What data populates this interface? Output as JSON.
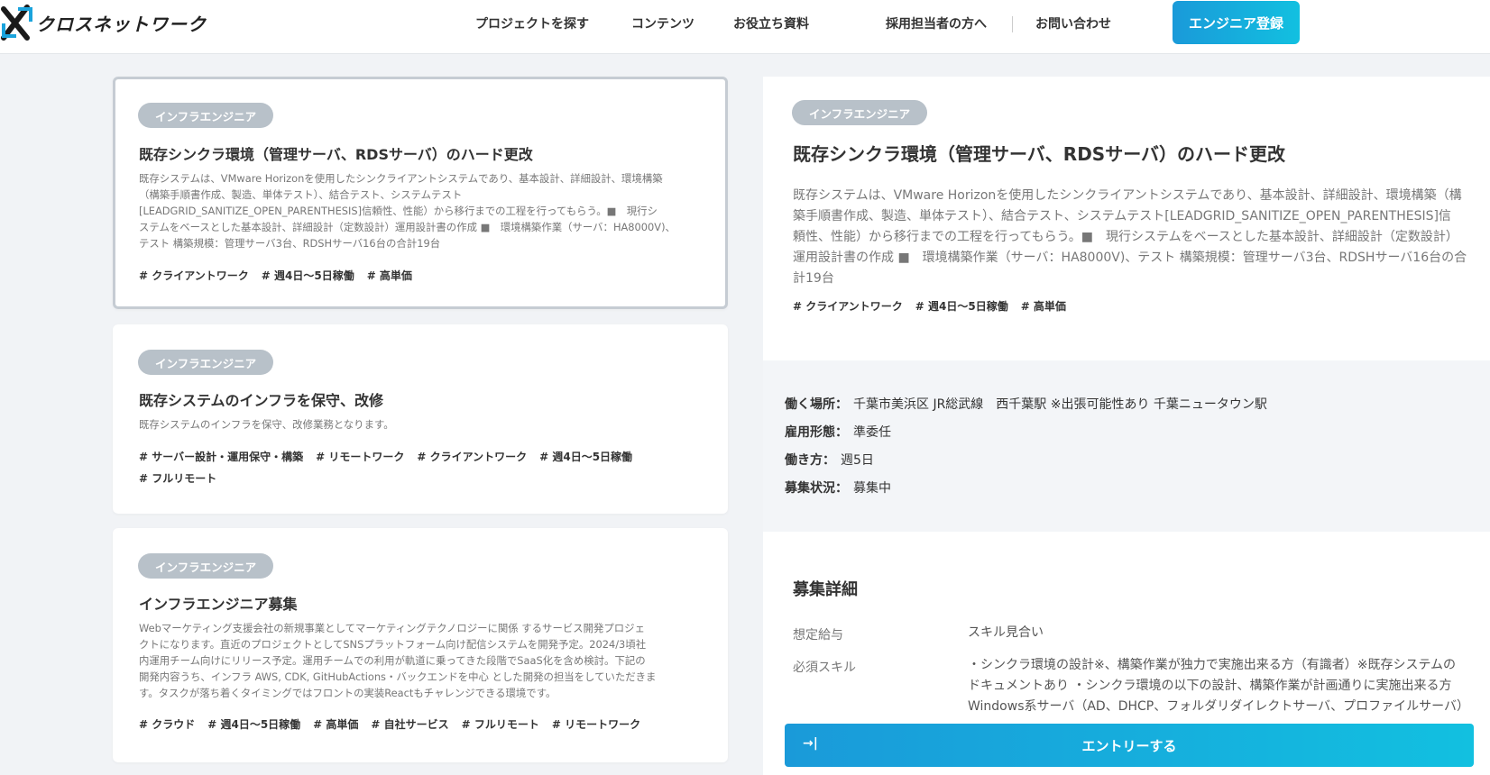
{
  "brand": {
    "name": "クロスネットワーク"
  },
  "nav": {
    "items": [
      "プロジェクトを探す",
      "コンテンツ",
      "お役立ち資料",
      "採用担当者の方へ",
      "お問い合わせ"
    ],
    "cta": "エンジニア登録"
  },
  "cards": [
    {
      "category": "インフラエンジニア",
      "title": "既存シンクラ環境（管理サーバ、RDSサーバ）のハード更改",
      "desc_lines": [
        "既存システムは、VMware Horizonを使用したシンクライアントシステムであり、基本設計、詳細設計、環境構築",
        "（構築手順書作成、製造、単体テスト）、結合テスト、システムテスト",
        "[LEADGRID_SANITIZE_OPEN_PARENTHESIS]信頼性、性能）から移行までの工程を行ってもらう。■　現行シ",
        "ステムをベースとした基本設計、詳細設計（定数設計）運用設計書の作成 ■　環境構築作業（サーバ：HA8000V)、",
        "テスト 構築規模：管理サーバ3台、RDSHサーバ16台の合計19台"
      ],
      "tags": [
        "# クライアントワーク",
        "# 週4日～5日稼働",
        "# 高単価"
      ]
    },
    {
      "category": "インフラエンジニア",
      "title": "既存システムのインフラを保守、改修",
      "desc_lines": [
        "既存システムのインフラを保守、改修業務となります。"
      ],
      "tags": [
        "# サーバー設計・運用保守・構築",
        "# リモートワーク",
        "# クライアントワーク",
        "# 週4日～5日稼働",
        "# フルリモート"
      ]
    },
    {
      "category": "インフラエンジニア",
      "title": "インフラエンジニア募集",
      "desc_lines": [
        "Webマーケティング支援会社の新規事業としてマーケティングテクノロジーに関係 するサービス開発プロジェ",
        "クトになります。直近のプロジェクトとしてSNSプラットフォーム向け配信システムを開発予定。2024/3頃社",
        "内運用チーム向けにリリース予定。運用チームでの利用が軌道に乗ってきた段階でSaaS化を含め検討。下記の",
        "開発内容うち、インフラ AWS, CDK, GitHubActions・バックエンドを中心 とした開発の担当をしていただきま",
        "す。タスクが落ち着くタイミングではフロントの実装Reactもチャレンジできる環境です。"
      ],
      "tags": [
        "# クラウド",
        "# 週4日～5日稼働",
        "# 高単価",
        "# 自社サービス",
        "# フルリモート",
        "# リモートワーク"
      ]
    }
  ],
  "detail": {
    "category": "インフラエンジニア",
    "title": "既存シンクラ環境（管理サーバ、RDSサーバ）のハード更改",
    "desc_lines": [
      "既存システムは、VMware Horizonを使用したシンクライアントシステムであり、基本設計、詳細設計、環境構築（構",
      "築手順書作成、製造、単体テスト）、結合テスト、システムテスト[LEADGRID_SANITIZE_OPEN_PARENTHESIS]信",
      "頼性、性能）から移行までの工程を行ってもらう。■　現行システムをベースとした基本設計、詳細設計（定数設計）",
      "運用設計書の作成 ■　環境構築作業（サーバ：HA8000V)、テスト 構築規模：管理サーバ3台、RDSHサーバ16台の合",
      "計19台"
    ],
    "tags": [
      "# クライアントワーク",
      "# 週4日～5日稼働",
      "# 高単価"
    ],
    "info": [
      {
        "label": "働く場所：",
        "value": "千葉市美浜区 JR総武線　西千葉駅 ※出張可能性あり 千葉ニュータウン駅"
      },
      {
        "label": "雇用形態：",
        "value": "準委任"
      },
      {
        "label": "働き方：",
        "value": "週5日"
      },
      {
        "label": "募集状況：",
        "value": "募集中"
      }
    ],
    "section_title": "募集詳細",
    "specs": [
      {
        "label": "想定給与",
        "value_lines": [
          "スキル見合い"
        ]
      },
      {
        "label": "必須スキル",
        "value_lines": [
          "・シンクラ環境の設計※、構築作業が独力で実施出来る方（有識者）※既存システムの",
          "ドキュメントあり ・シンクラ環境の以下の設計、構築作業が計画通りに実施出来る方",
          "Windows系サーバ（AD、DHCP、フォルダリダイレクトサーバ、プロファイルサーバ）"
        ]
      }
    ],
    "entry_button": "エントリーする",
    "entry_icon": "→|"
  }
}
